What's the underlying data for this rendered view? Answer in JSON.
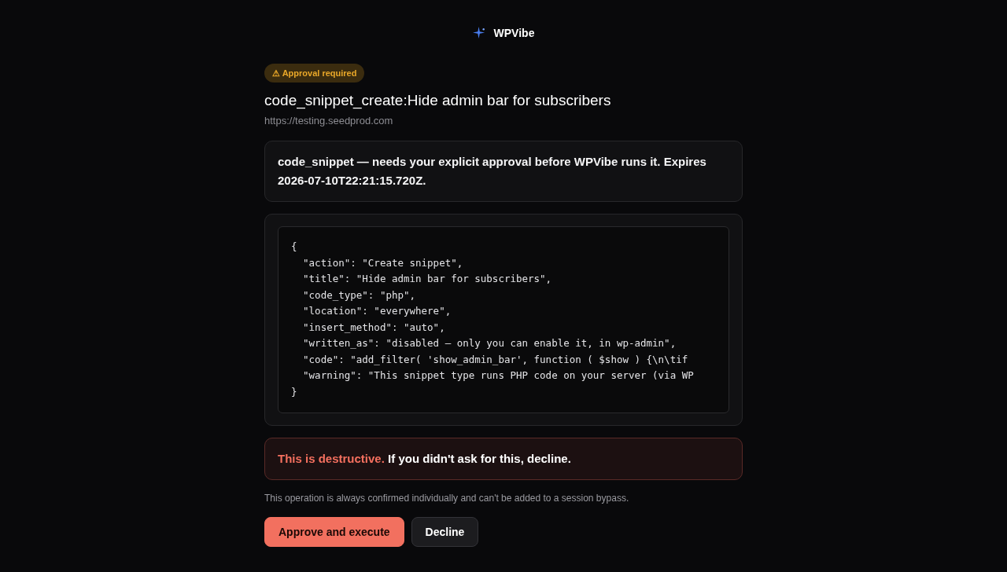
{
  "header": {
    "brand": "WPVibe"
  },
  "badge": {
    "label": "⚠ Approval required"
  },
  "title": "code_snippet_create:Hide admin bar for subscribers",
  "url": "https://testing.seedprod.com",
  "summary": "code_snippet — needs your explicit approval before WPVibe runs it. Expires 2026-07-10T22:21:15.720Z.",
  "payload": {
    "lines": [
      "{",
      "  \"action\": \"Create snippet\",",
      "  \"title\": \"Hide admin bar for subscribers\",",
      "  \"code_type\": \"php\",",
      "  \"location\": \"everywhere\",",
      "  \"insert_method\": \"auto\",",
      "  \"written_as\": \"disabled — only you can enable it, in wp-admin\",",
      "  \"code\": \"add_filter( 'show_admin_bar', function ( $show ) {\\n\\tif",
      "  \"warning\": \"This snippet type runs PHP code on your server (via WP",
      "}"
    ]
  },
  "warning": {
    "text": "**This is destructive.** If you didn't ask for this, decline."
  },
  "note": "This operation is always confirmed individually and can't be added to a session bypass.",
  "buttons": [
    {
      "label": "Approve and execute",
      "kind": "primary"
    },
    {
      "label": "Decline",
      "kind": "secondary"
    }
  ]
}
